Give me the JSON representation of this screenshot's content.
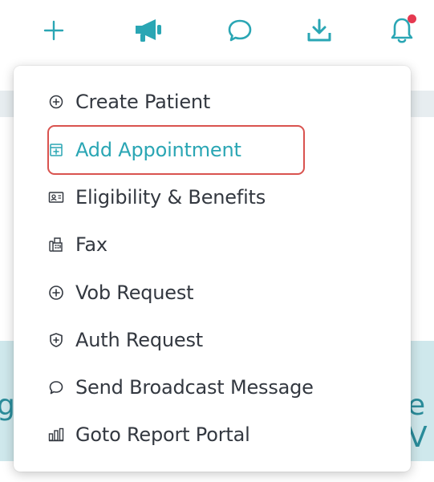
{
  "colors": {
    "accent": "#2aa6b4",
    "text": "#333840",
    "highlight": "#d9534f",
    "notification_dot": "#e53950",
    "banner": "#cfe8ec"
  },
  "toolbar": {
    "icons": [
      "plus-icon",
      "megaphone-icon",
      "chat-icon",
      "download-icon",
      "bell-icon"
    ],
    "has_notification": true
  },
  "background": {
    "banner_left_fragment": "g",
    "banner_right_fragment": "e V"
  },
  "menu": {
    "items": [
      {
        "label": "Create Patient",
        "icon": "plus-circle-icon",
        "active": false
      },
      {
        "label": "Add Appointment",
        "icon": "calendar-plus-icon",
        "active": true
      },
      {
        "label": "Eligibility & Benefits",
        "icon": "id-card-icon",
        "active": false
      },
      {
        "label": "Fax",
        "icon": "fax-icon",
        "active": false
      },
      {
        "label": "Vob Request",
        "icon": "plus-circle-icon",
        "active": false
      },
      {
        "label": "Auth Request",
        "icon": "shield-plus-icon",
        "active": false
      },
      {
        "label": "Send Broadcast Message",
        "icon": "chat-bubble-icon",
        "active": false
      },
      {
        "label": "Goto Report Portal",
        "icon": "bar-chart-icon",
        "active": false
      }
    ]
  }
}
